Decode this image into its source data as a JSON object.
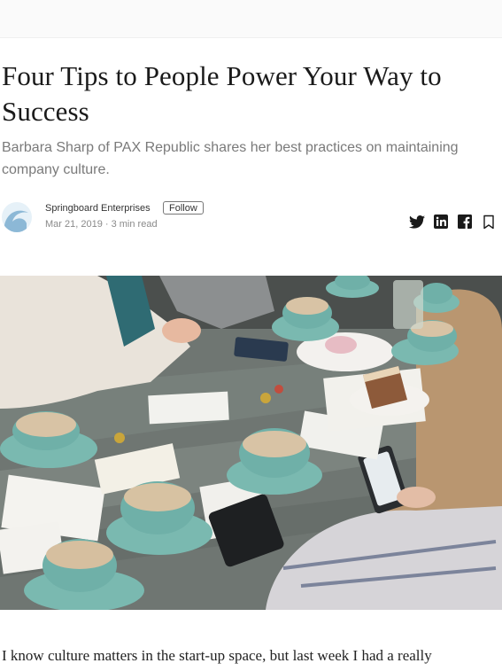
{
  "article": {
    "title": "Four Tips to People Power Your Way to Success",
    "subtitle": "Barbara Sharp of PAX Republic shares her best practices on maintaining company culture.",
    "first_paragraph": "I know culture matters in the start-up space, but last week I had a really"
  },
  "author": {
    "name": "Springboard Enterprises",
    "follow_label": "Follow",
    "meta": "Mar 21, 2019 · 3 min read",
    "avatar_colors": {
      "background": "#e6f1f8",
      "wave": "#8cb8d6"
    }
  },
  "share": {
    "icons": [
      "twitter-icon",
      "linkedin-icon",
      "facebook-icon",
      "bookmark-icon"
    ],
    "color": "#1a1a1a"
  },
  "hero": {
    "palette": {
      "table": "#6f7672",
      "cups": "#6fb0a8",
      "saucer": "#7ab9b0",
      "cream": "#d8c3a5",
      "sweater": "#e9e3da"
    }
  }
}
